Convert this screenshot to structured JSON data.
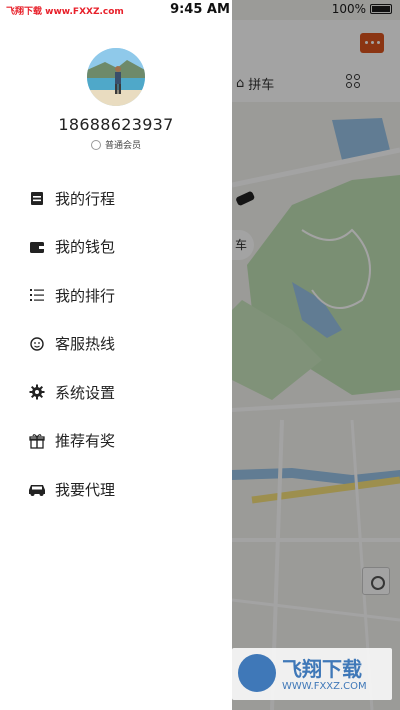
{
  "status_bar": {
    "carrier_watermark": "飞翔下载 www.FXXZ.com",
    "time": "9:45 AM",
    "battery": "100%"
  },
  "drawer": {
    "phone": "18688623937",
    "member_level": "普通会员",
    "menu": [
      {
        "label": "我的行程",
        "icon": "itinerary-icon"
      },
      {
        "label": "我的钱包",
        "icon": "wallet-icon"
      },
      {
        "label": "我的排行",
        "icon": "ranking-icon"
      },
      {
        "label": "客服热线",
        "icon": "customer-service-icon"
      },
      {
        "label": "系统设置",
        "icon": "settings-icon"
      },
      {
        "label": "推荐有奖",
        "icon": "gift-icon"
      },
      {
        "label": "我要代理",
        "icon": "agent-car-icon"
      }
    ]
  },
  "map_panel": {
    "tab_carpool": "拼车",
    "chip_label": "车",
    "watermark_title": "飞翔下载",
    "watermark_url": "WWW.FXXZ.COM"
  },
  "colors": {
    "accent": "#d9531e",
    "watermark_blue": "#3f78b8",
    "status_red": "#e8202a"
  }
}
